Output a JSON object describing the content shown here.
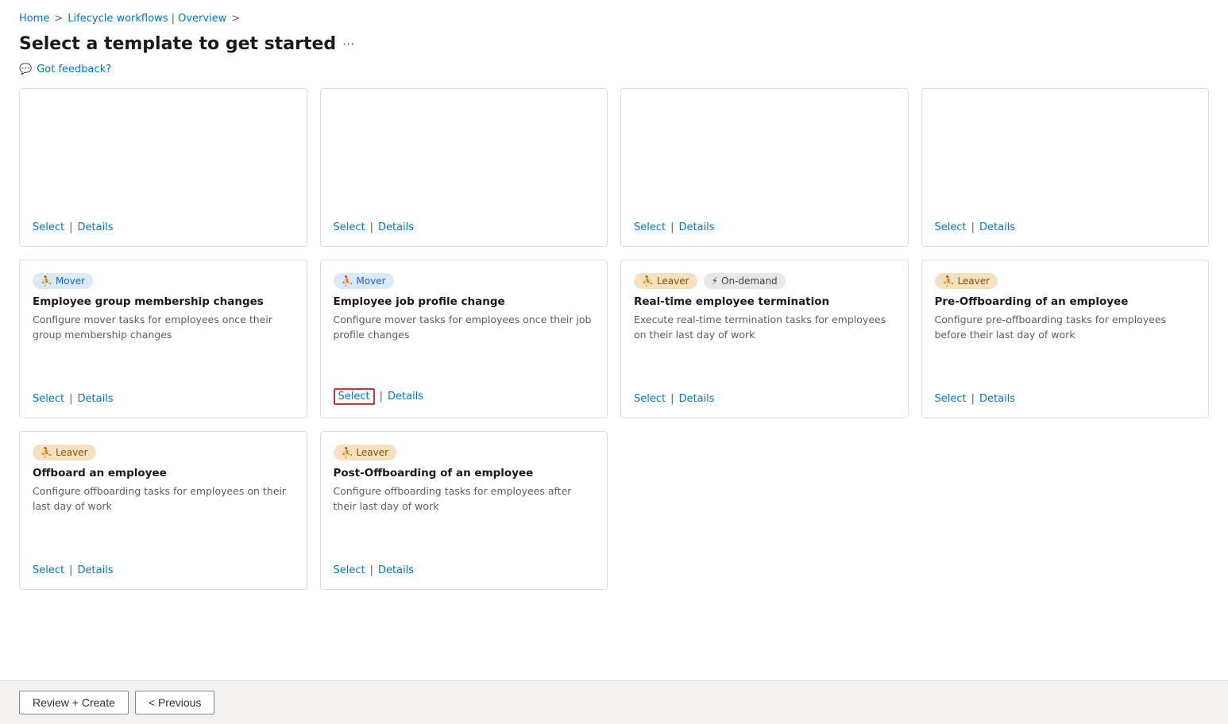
{
  "breadcrumb": {
    "home": "Home",
    "sep1": ">",
    "lifecycle": "Lifecycle workflows | Overview",
    "sep2": ">"
  },
  "page": {
    "title": "Select a template to get started",
    "more_icon": "···",
    "feedback": "Got feedback?"
  },
  "cards_row1": [
    {
      "id": "card-1-1",
      "badges": [],
      "title": "",
      "desc": "",
      "select_highlighted": false,
      "select_label": "Select",
      "details_label": "Details"
    },
    {
      "id": "card-1-2",
      "badges": [],
      "title": "",
      "desc": "",
      "select_highlighted": false,
      "select_label": "Select",
      "details_label": "Details"
    },
    {
      "id": "card-1-3",
      "badges": [],
      "title": "",
      "desc": "",
      "select_highlighted": false,
      "select_label": "Select",
      "details_label": "Details"
    },
    {
      "id": "card-1-4",
      "badges": [],
      "title": "",
      "desc": "",
      "select_highlighted": false,
      "select_label": "Select",
      "details_label": "Details"
    }
  ],
  "cards_row2": [
    {
      "id": "card-2-1",
      "badges": [
        {
          "type": "mover",
          "label": "Mover"
        }
      ],
      "title": "Employee group membership changes",
      "desc": "Configure mover tasks for employees once their group membership changes",
      "select_highlighted": false,
      "select_label": "Select",
      "details_label": "Details"
    },
    {
      "id": "card-2-2",
      "badges": [
        {
          "type": "mover",
          "label": "Mover"
        }
      ],
      "title": "Employee job profile change",
      "desc": "Configure mover tasks for employees once their job profile changes",
      "select_highlighted": true,
      "select_label": "Select",
      "details_label": "Details"
    },
    {
      "id": "card-2-3",
      "badges": [
        {
          "type": "leaver",
          "label": "Leaver"
        },
        {
          "type": "ondemand",
          "label": "On-demand"
        }
      ],
      "title": "Real-time employee termination",
      "desc": "Execute real-time termination tasks for employees on their last day of work",
      "select_highlighted": false,
      "select_label": "Select",
      "details_label": "Details"
    },
    {
      "id": "card-2-4",
      "badges": [
        {
          "type": "leaver",
          "label": "Leaver"
        }
      ],
      "title": "Pre-Offboarding of an employee",
      "desc": "Configure pre-offboarding tasks for employees before their last day of work",
      "select_highlighted": false,
      "select_label": "Select",
      "details_label": "Details"
    }
  ],
  "cards_row3": [
    {
      "id": "card-3-1",
      "badges": [
        {
          "type": "leaver",
          "label": "Leaver"
        }
      ],
      "title": "Offboard an employee",
      "desc": "Configure offboarding tasks for employees on their last day of work",
      "select_highlighted": false,
      "select_label": "Select",
      "details_label": "Details"
    },
    {
      "id": "card-3-2",
      "badges": [
        {
          "type": "leaver",
          "label": "Leaver"
        }
      ],
      "title": "Post-Offboarding of an employee",
      "desc": "Configure offboarding tasks for employees after their last day of work",
      "select_highlighted": false,
      "select_label": "Select",
      "details_label": "Details"
    }
  ],
  "bottom_bar": {
    "review_create": "Review + Create",
    "previous": "< Previous"
  }
}
